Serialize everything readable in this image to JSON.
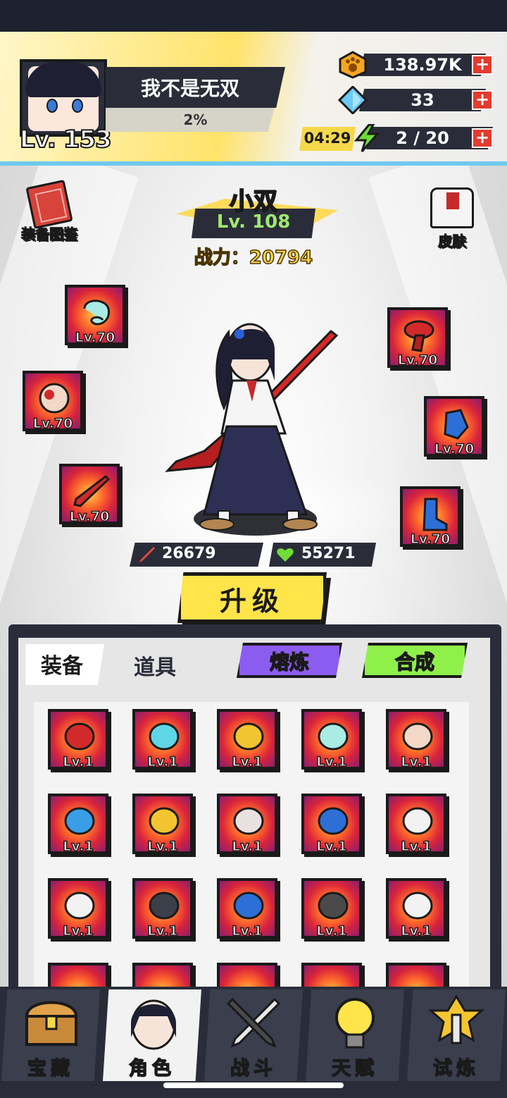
{
  "player": {
    "name": "我不是无双",
    "level": "Lv. 153",
    "exp": "2%"
  },
  "resources": {
    "coins": "138.97K",
    "gems": "33",
    "stamina": "2 / 20",
    "timer": "04:29",
    "plus": "+"
  },
  "side": {
    "codex": "装备图鉴",
    "skin": "皮肤"
  },
  "hero": {
    "name": "小双",
    "level": "Lv. 108",
    "power": "战力：20794",
    "attack": "26679",
    "hp": "55271"
  },
  "slots": {
    "left": [
      "Lv.70",
      "Lv.70",
      "Lv.70"
    ],
    "right": [
      "Lv.70",
      "Lv.70",
      "Lv.70"
    ]
  },
  "upgrade": "升级",
  "tabs": {
    "equip": "装备",
    "items": "道具",
    "smelt": "熔炼",
    "combine": "合成"
  },
  "inventory": [
    {
      "name": "red-sword",
      "level": "Lv.1",
      "color": "#d22a2a"
    },
    {
      "name": "cyan-blade",
      "level": "Lv.1",
      "color": "#5fd6e6"
    },
    {
      "name": "gold-sword",
      "level": "Lv.1",
      "color": "#f2c530"
    },
    {
      "name": "jade-ring",
      "level": "Lv.1",
      "color": "#a9ece3"
    },
    {
      "name": "seal-ring",
      "level": "Lv.1",
      "color": "#f3d7c7"
    },
    {
      "name": "blue-necklace",
      "level": "Lv.1",
      "color": "#3a9ee6"
    },
    {
      "name": "gold-pendant",
      "level": "Lv.1",
      "color": "#f2c530"
    },
    {
      "name": "pearl-necklace",
      "level": "Lv.1",
      "color": "#e9e0e0"
    },
    {
      "name": "sapphire-pendant",
      "level": "Lv.1",
      "color": "#2d6fd6"
    },
    {
      "name": "white-cap",
      "level": "Lv.1",
      "color": "#f2f2f2"
    },
    {
      "name": "white-mask",
      "level": "Lv.1",
      "color": "#f2f2f2"
    },
    {
      "name": "dark-helmet",
      "level": "Lv.1",
      "color": "#3b3f4a"
    },
    {
      "name": "blue-gloves",
      "level": "Lv.1",
      "color": "#2d6fd6"
    },
    {
      "name": "tactical-vest",
      "level": "Lv.1",
      "color": "#4a4a4a"
    },
    {
      "name": "karate-gi",
      "level": "Lv.1",
      "color": "#f2f2f2"
    }
  ],
  "nav": [
    "宝藏",
    "角色",
    "战斗",
    "天赋",
    "试炼"
  ],
  "colors": {
    "accent": "#ffe44a",
    "panel": "#2a2d39",
    "smelt": "#8c5cf0",
    "combine": "#8ff04a",
    "levelGreen": "#9fe870"
  }
}
